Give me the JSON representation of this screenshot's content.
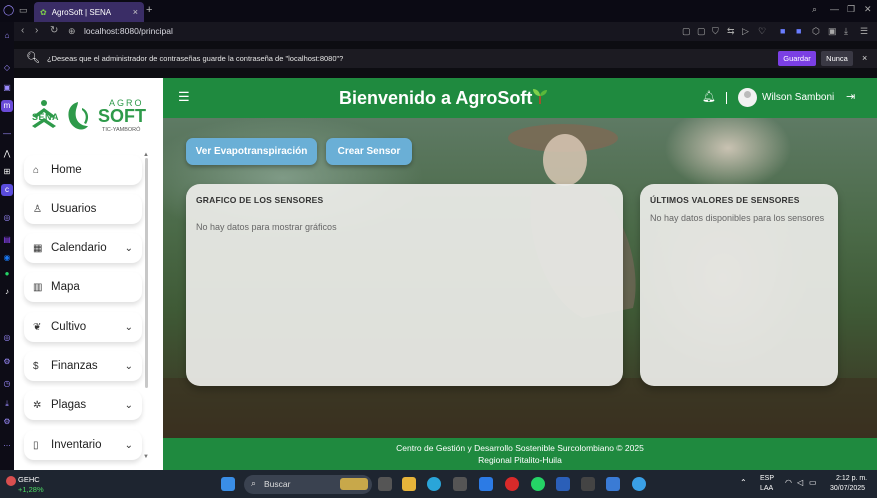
{
  "browser": {
    "tab_title": "AgroSoft | SENA",
    "tab_close": "×",
    "new_tab": "+",
    "url": "localhost:8080/principal"
  },
  "password_prompt": {
    "message": "¿Deseas que el administrador de contraseñas guarde la contraseña de \"localhost:8080\"?",
    "save_label": "Guardar",
    "never_label": "Nunca",
    "close": "×"
  },
  "logo": {
    "sena": "SENA",
    "agro": "AGRO",
    "soft": "SOFT",
    "tagline": "TIC-YAMBORÓ"
  },
  "sidebar": {
    "items": [
      {
        "label": "Home",
        "icon": "home-icon",
        "chevron": false
      },
      {
        "label": "Usuarios",
        "icon": "user-icon",
        "chevron": true
      },
      {
        "label": "Calendario",
        "icon": "calendar-icon",
        "chevron": true
      },
      {
        "label": "Mapa",
        "icon": "map-icon",
        "chevron": false
      },
      {
        "label": "Cultivo",
        "icon": "leaf-icon",
        "chevron": true
      },
      {
        "label": "Finanzas",
        "icon": "dollar-icon",
        "chevron": true
      },
      {
        "label": "Plagas",
        "icon": "bug-icon",
        "chevron": true
      },
      {
        "label": "Inventario",
        "icon": "clipboard-icon",
        "chevron": true
      }
    ]
  },
  "header": {
    "title": "Bienvenido a AgroSoft",
    "user_name": "Wilson Samboni",
    "brand_color": "#1f8a3f"
  },
  "main": {
    "buttons": {
      "evapo": "Ver Evapotranspiración",
      "sensor": "Crear Sensor"
    },
    "graph_card": {
      "title": "GRAFICO DE LOS SENSORES",
      "empty": "No hay datos para mostrar gráficos"
    },
    "last_card": {
      "title": "ÚLTIMOS VALORES DE SENSORES",
      "empty": "No hay datos disponibles para los sensores"
    }
  },
  "footer": {
    "line1": "Centro de Gestión y Desarrollo Sostenible Surcolombiano © 2025",
    "line2": "Regional Pitalito-Huila"
  },
  "taskbar": {
    "search_placeholder": "Buscar",
    "stock_name": "GEHC",
    "stock_change": "+1,28%",
    "lang_1": "ESP",
    "lang_2": "LAA",
    "time": "2:12 p. m.",
    "date": "30/07/2025"
  }
}
